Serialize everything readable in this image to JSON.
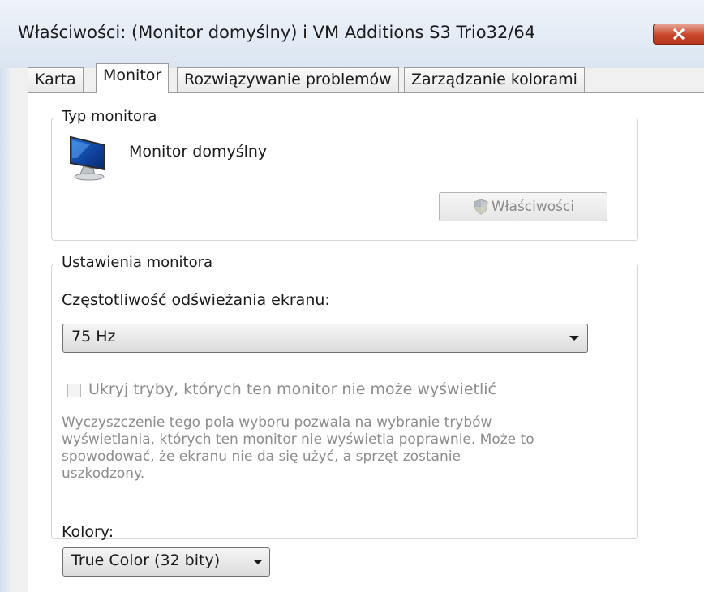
{
  "window": {
    "title": "Właściwości: (Monitor domyślny) i VM Additions S3 Trio32/64",
    "close_icon": "close-icon"
  },
  "tabs": [
    {
      "label": "Karta",
      "active": false
    },
    {
      "label": "Monitor",
      "active": true
    },
    {
      "label": "Rozwiązywanie problemów",
      "active": false
    },
    {
      "label": "Zarządzanie kolorami",
      "active": false
    }
  ],
  "monitor_type": {
    "group_label": "Typ monitora",
    "monitor_name": "Monitor domyślny",
    "icon": "monitor-icon",
    "properties_button": "Właściwości",
    "properties_button_icon": "shield-icon",
    "properties_enabled": false
  },
  "monitor_settings": {
    "group_label": "Ustawienia monitora",
    "refresh_label": "Częstotliwość odświeżania ekranu:",
    "refresh_value": "75 Hz",
    "hide_modes_label": "Ukryj tryby, których ten monitor nie może wyświetlić",
    "hide_modes_checked": false,
    "hide_modes_enabled": false,
    "description": "Wyczyszczenie tego pola wyboru pozwala na wybranie trybów\nwyświetlania, których ten monitor nie wyświetla poprawnie. Może to\nspowodować, że ekranu nie da się użyć, a sprzęt zostanie\nuszkodzony."
  },
  "colors": {
    "label": "Kolory:",
    "value": "True Color (32 bity)"
  },
  "theme": {
    "close_button": "#c8452b",
    "disabled_text": "#8d8d8d"
  }
}
